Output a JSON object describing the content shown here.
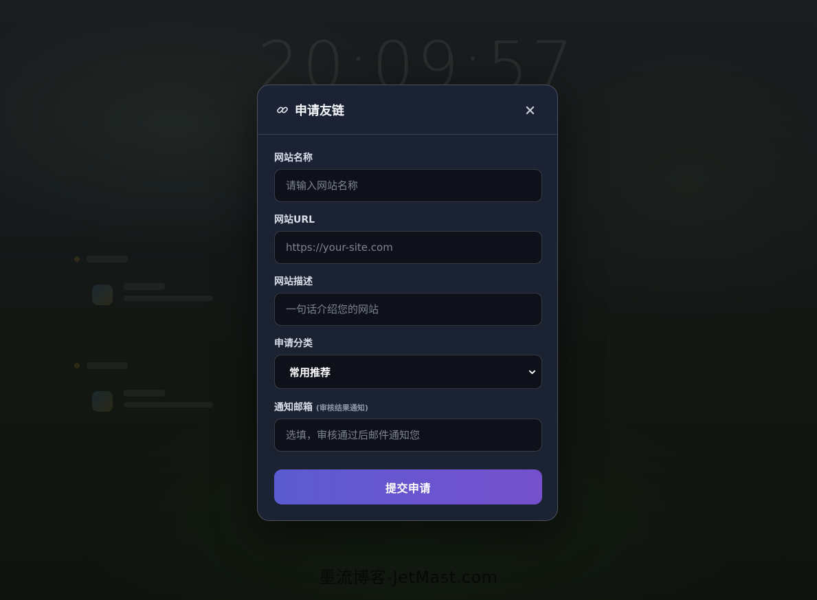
{
  "background": {
    "clock": "20:09:57",
    "watermark": "墨流博客-JetMast.com"
  },
  "modal": {
    "title": "申请友链",
    "title_icon": "link-icon",
    "close_icon": "close-icon",
    "fields": {
      "site_name": {
        "label": "网站名称",
        "placeholder": "请输入网站名称",
        "value": ""
      },
      "site_url": {
        "label": "网站URL",
        "placeholder": "https://your-site.com",
        "value": ""
      },
      "site_desc": {
        "label": "网站描述",
        "placeholder": "一句话介绍您的网站",
        "value": ""
      },
      "category": {
        "label": "申请分类",
        "selected": "常用推荐"
      },
      "email": {
        "label": "通知邮箱",
        "hint": "(审核结果通知)",
        "placeholder": "选填，审核通过后邮件通知您",
        "value": ""
      }
    },
    "submit_label": "提交申请"
  },
  "colors": {
    "modal_bg": "#1b2232",
    "input_bg": "#0e1119",
    "button_start": "#5b5bd0",
    "button_end": "#7450cc"
  }
}
